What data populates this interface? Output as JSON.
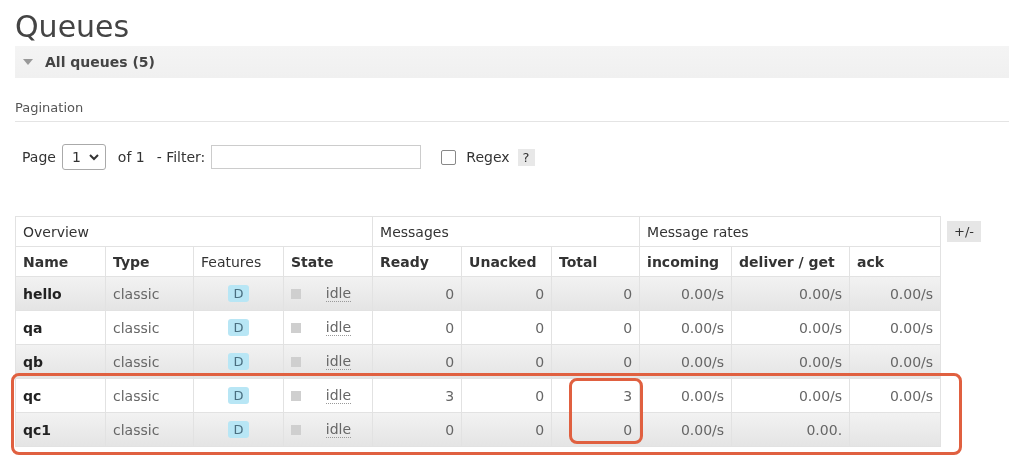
{
  "title": "Queues",
  "section": {
    "label": "All queues (5)",
    "expanded": true
  },
  "pagination": {
    "heading": "Pagination",
    "page_label": "Page",
    "page_value": "1",
    "of_label": "of 1",
    "filter_label": "- Filter:",
    "regex_label": "Regex",
    "regex_checked": false,
    "help": "?"
  },
  "table": {
    "groups": [
      {
        "label": "Overview",
        "columns": [
          {
            "label": "Name",
            "bold": true
          },
          {
            "label": "Type",
            "bold": true
          },
          {
            "label": "Features",
            "bold": false
          },
          {
            "label": "State",
            "bold": true
          }
        ]
      },
      {
        "label": "Messages",
        "columns": [
          {
            "label": "Ready",
            "bold": true
          },
          {
            "label": "Unacked",
            "bold": true
          },
          {
            "label": "Total",
            "bold": true
          }
        ]
      },
      {
        "label": "Message rates",
        "columns": [
          {
            "label": "incoming",
            "bold": true
          },
          {
            "label": "deliver / get",
            "bold": true
          },
          {
            "label": "ack",
            "bold": true
          }
        ]
      }
    ],
    "rows": [
      {
        "name": "hello",
        "type": "classic",
        "feature": "D",
        "state": "idle",
        "values": [
          "0",
          "0",
          "0",
          "0.00/s",
          "0.00/s",
          "0.00/s"
        ],
        "annotated": false,
        "total_annotated": false
      },
      {
        "name": "qa",
        "type": "classic",
        "feature": "D",
        "state": "idle",
        "values": [
          "0",
          "0",
          "0",
          "0.00/s",
          "0.00/s",
          "0.00/s"
        ],
        "annotated": false,
        "total_annotated": false
      },
      {
        "name": "qb",
        "type": "classic",
        "feature": "D",
        "state": "idle",
        "values": [
          "0",
          "0",
          "0",
          "0.00/s",
          "0.00/s",
          "0.00/s"
        ],
        "annotated": false,
        "total_annotated": false
      },
      {
        "name": "qc",
        "type": "classic",
        "feature": "D",
        "state": "idle",
        "values": [
          "3",
          "0",
          "3",
          "0.00/s",
          "0.00/s",
          "0.00/s"
        ],
        "annotated": true,
        "total_annotated": true
      },
      {
        "name": "qc1",
        "type": "classic",
        "feature": "D",
        "state": "idle",
        "values": [
          "0",
          "0",
          "0",
          "0.00/s",
          "0.00."
        ],
        "annotated": true,
        "total_annotated": true
      }
    ]
  },
  "column_toggle": "+/-"
}
